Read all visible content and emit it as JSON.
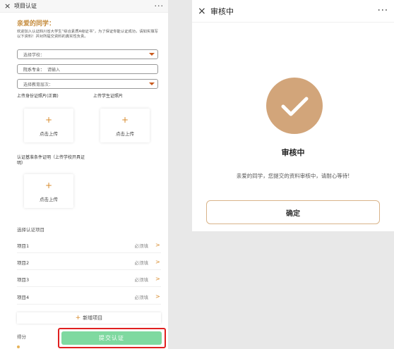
{
  "left": {
    "header": {
      "close_icon": "×",
      "title": "项目认证",
      "more_icon": "···"
    },
    "greeting": "亲爱的同学：",
    "intro": "欢迎加入认证四川省大学生“综合素质A级证书”，为了保证你能认证成功，请如实填写以下资料！并对所提交资料的真实性负责。",
    "school_select": {
      "placeholder": "选择学校："
    },
    "major_field": {
      "label": "院系专业：",
      "placeholder": "请输入"
    },
    "education_select": {
      "placeholder": "选择教育层次："
    },
    "upload_id": {
      "label": "上传身份证照片(正面)",
      "plus": "+",
      "action": "点击上传"
    },
    "upload_student": {
      "label": "上传学生证照片",
      "plus": "+",
      "action": "点击上传"
    },
    "upload_proof": {
      "label": "认证基准条件证明（上传学校开具证明）",
      "plus": "+",
      "action": "点击上传"
    },
    "projects_header": "选择认证项目",
    "projects": [
      {
        "name": "项目1",
        "required": "必须填",
        "arrow": ">"
      },
      {
        "name": "项目2",
        "required": "必须填",
        "arrow": ">"
      },
      {
        "name": "项目3",
        "required": "必须填",
        "arrow": ">"
      },
      {
        "name": "项目4",
        "required": "必须填",
        "arrow": ">"
      }
    ],
    "add_project": {
      "plus": "+",
      "label": "新增项目"
    },
    "score_label": "得分",
    "submit_label": "提交认证"
  },
  "right": {
    "header": {
      "close_icon": "×",
      "title": "审核中",
      "more_icon": "···"
    },
    "status_icon": "check-icon",
    "status_title": "审核中",
    "status_message": "亲爱的同学，您提交的资料审核中，请耐心等待!",
    "confirm_label": "确定"
  },
  "colors": {
    "accent": "#c48a3a",
    "check_circle": "#d2a57a",
    "submit_bg": "#7fd9a0",
    "highlight_border": "#e02020"
  }
}
